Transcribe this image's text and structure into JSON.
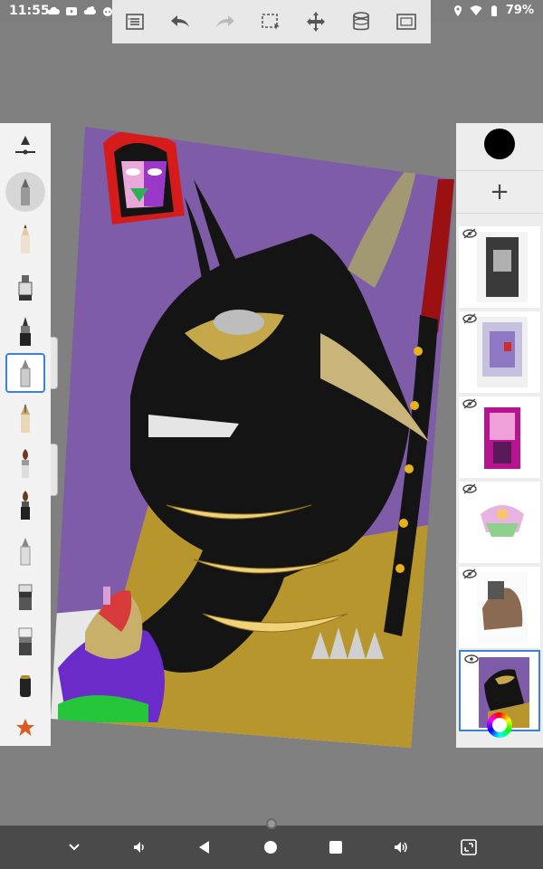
{
  "status_bar": {
    "time": "11:55",
    "battery_percent": "79%",
    "left_icons": [
      "cloud-icon",
      "youtube-icon",
      "cloud-sync-icon",
      "reddit-icon",
      "dot-icon"
    ],
    "right_icons": [
      "location-icon",
      "wifi-icon",
      "battery-icon"
    ]
  },
  "toolbar": {
    "buttons": [
      "list-icon",
      "undo-icon",
      "redo-icon",
      "selection-icon",
      "move-icon",
      "layers-stack-icon",
      "fullscreen-icon"
    ]
  },
  "tools": {
    "items": [
      "ruler-icon",
      "pencil-icon",
      "hard-pencil-icon",
      "marker-icon",
      "airbrush-icon",
      "inking-pen-icon",
      "fountain-pen-icon",
      "brush-icon",
      "paint-brush-icon",
      "smudge-icon",
      "eraser-icon",
      "soft-eraser-icon",
      "fill-icon",
      "favorites-icon"
    ],
    "active": "inking-pen-icon"
  },
  "layers": {
    "current_color": "#000000",
    "count_visible": 6,
    "selected_index": 5
  },
  "nav_bar": {
    "buttons": [
      "chevron-down-icon",
      "volume-down-icon",
      "back-icon",
      "home-icon",
      "recents-icon",
      "volume-up-icon",
      "screen-rotate-icon"
    ]
  },
  "colors": {
    "accent": "#3b82d6",
    "canvas_bg": "#7e5ca8",
    "gold": "#b8962e"
  }
}
